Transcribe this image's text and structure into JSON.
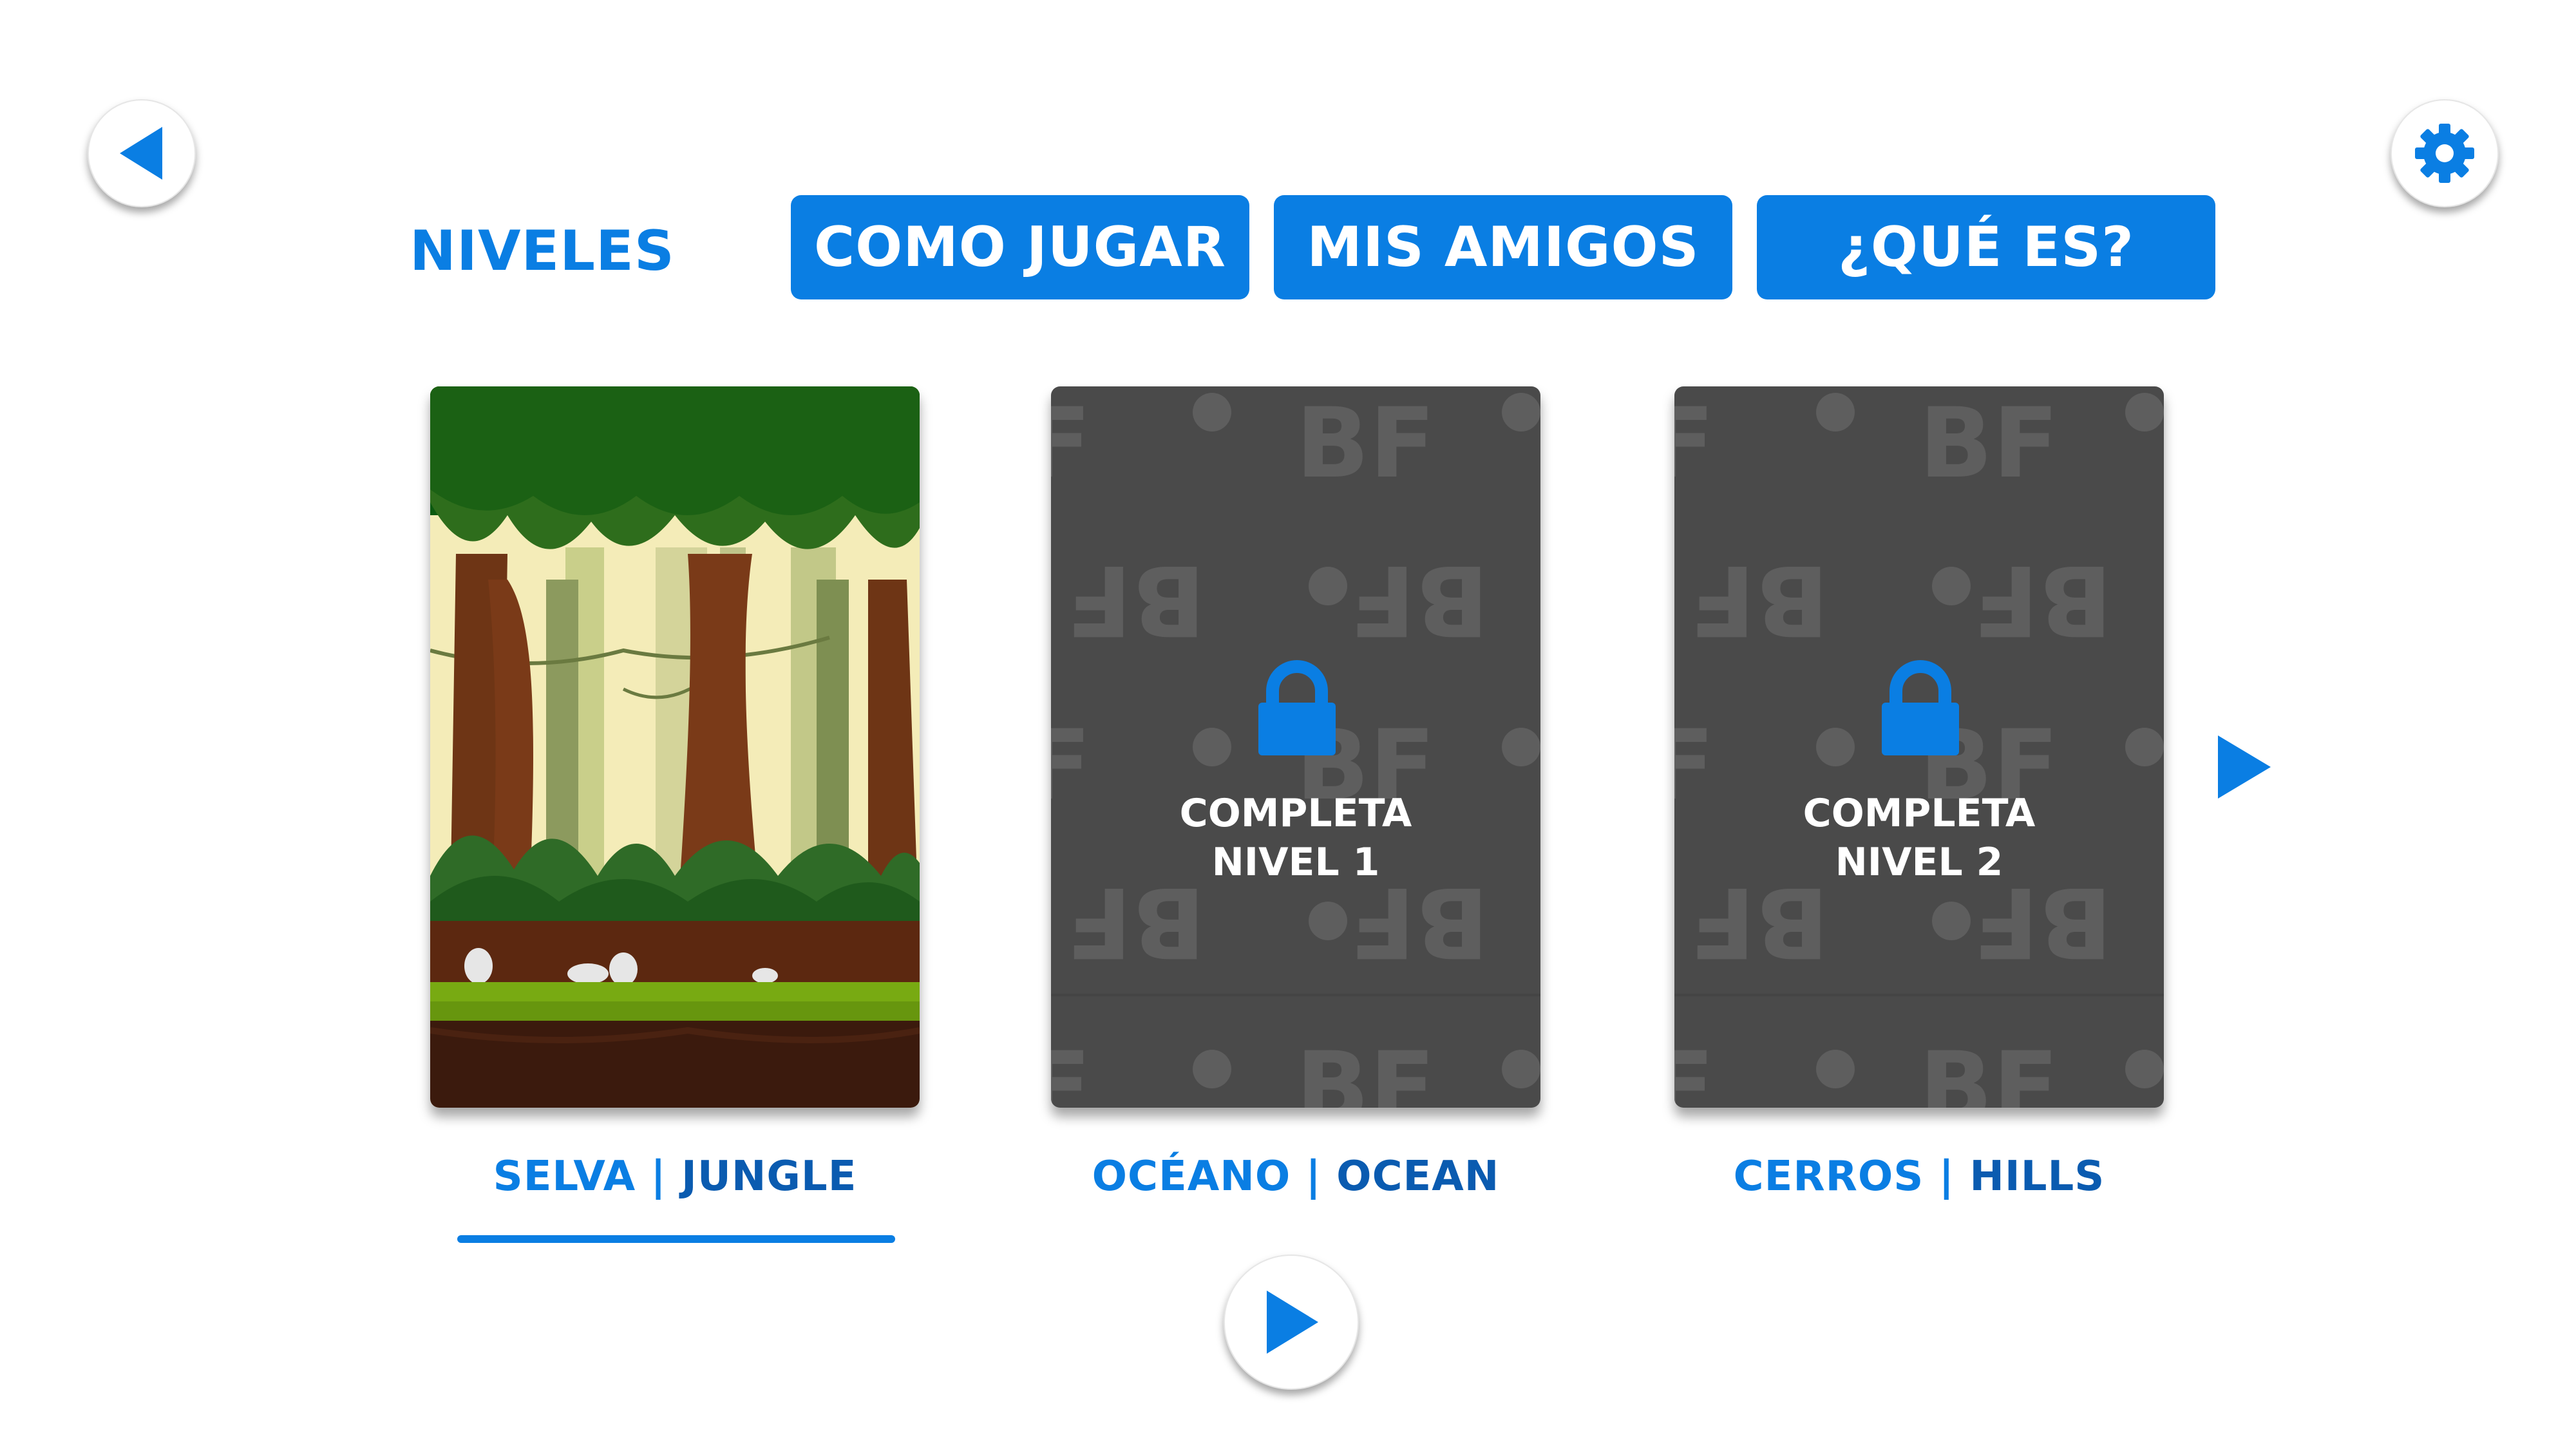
{
  "header": {
    "title": "NIVELES",
    "tabs": [
      {
        "label": "COMO JUGAR"
      },
      {
        "label": "MIS AMIGOS"
      },
      {
        "label": "¿QUÉ ES?"
      }
    ]
  },
  "levels": [
    {
      "label_es": "SELVA",
      "separator": "|",
      "label_en": "JUNGLE",
      "locked": false,
      "selected": true
    },
    {
      "label_es": "OCÉANO",
      "separator": "|",
      "label_en": "OCEAN",
      "locked": true,
      "lock_line1": "COMPLETA",
      "lock_line2": "NIVEL 1"
    },
    {
      "label_es": "CERROS",
      "separator": "|",
      "label_en": "HILLS",
      "locked": true,
      "lock_line1": "COMPLETA",
      "lock_line2": "NIVEL 2"
    }
  ],
  "pattern_text": "BF",
  "colors": {
    "accent": "#0a7ee3",
    "locked_card": "#4a4a4a",
    "pattern": "#5e5e5e"
  },
  "icons": {
    "back": "back-arrow-icon",
    "settings": "gear-icon",
    "next": "next-arrow-icon",
    "play": "play-icon",
    "lock": "lock-icon"
  }
}
